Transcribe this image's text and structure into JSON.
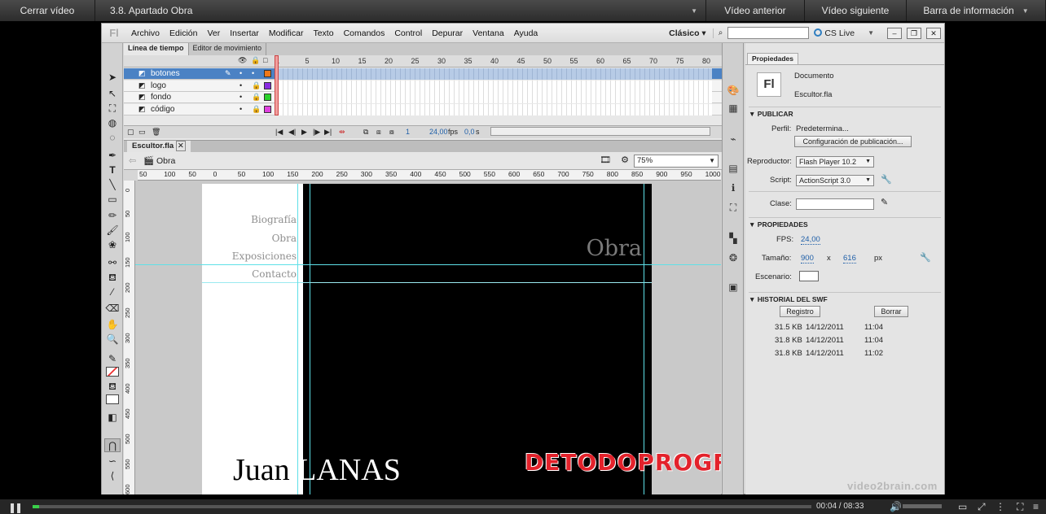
{
  "player": {
    "close_label": "Cerrar vídeo",
    "title": "3.8. Apartado Obra",
    "prev_label": "Vídeo anterior",
    "next_label": "Vídeo siguiente",
    "info_label": "Barra de información",
    "time": "00:04 / 08:33",
    "progress": 0.008,
    "brand": "video2brain.com"
  },
  "app": {
    "logo": "Fl",
    "menu": [
      "Archivo",
      "Edición",
      "Ver",
      "Insertar",
      "Modificar",
      "Texto",
      "Comandos",
      "Control",
      "Depurar",
      "Ventana",
      "Ayuda"
    ],
    "workspace": "Clásico",
    "search_value": "",
    "cslive": "CS Live"
  },
  "timeline": {
    "tabs": [
      "Línea de tiempo",
      "Editor de movimiento"
    ],
    "frame_numbers": [
      "1",
      "5",
      "10",
      "15",
      "20",
      "25",
      "30",
      "35",
      "40",
      "45",
      "50",
      "55",
      "60",
      "65",
      "70",
      "75",
      "80"
    ],
    "layers": [
      {
        "name": "botones",
        "color": "#f07818",
        "selected": true
      },
      {
        "name": "logo",
        "color": "#8a2be2",
        "selected": false
      },
      {
        "name": "fondo",
        "color": "#2bd12b",
        "selected": false
      },
      {
        "name": "código",
        "color": "#e040e0",
        "selected": false
      }
    ],
    "fps": "24,00",
    "fps_unit": "fps",
    "time": "0,0",
    "time_unit": "s",
    "frame": "1"
  },
  "document": {
    "tab": "Escultor.fla",
    "scene": "Obra",
    "zoom": "75%",
    "hruler": [
      "50",
      "100",
      "50",
      "0",
      "50",
      "100",
      "150",
      "200",
      "250",
      "300",
      "350",
      "400",
      "450",
      "500",
      "550",
      "600",
      "650",
      "700",
      "750",
      "800",
      "850",
      "900",
      "950",
      "1000"
    ],
    "vruler": [
      "0",
      "50",
      "100",
      "150",
      "200",
      "250",
      "300",
      "350",
      "400",
      "450",
      "500",
      "550",
      "600"
    ]
  },
  "stage": {
    "menu_items": [
      "Biografía",
      "Obra",
      "Exposiciones",
      "Contacto"
    ],
    "section_title": "Obra",
    "signature_dark": "Juan",
    "signature_light": "LANAS",
    "watermark": "DETODOPROGRAMAS.COM"
  },
  "properties": {
    "tab": "Propiedades",
    "doc_type": "Documento",
    "doc_name": "Escultor.fla",
    "publish_section": "PUBLICAR",
    "profile_label": "Perfil:",
    "profile_value": "Predetermina...",
    "publish_config_button": "Configuración de publicación...",
    "player_label": "Reproductor:",
    "player_value": "Flash Player 10.2",
    "script_label": "Script:",
    "script_value": "ActionScript 3.0",
    "class_label": "Clase:",
    "properties_section": "PROPIEDADES",
    "fps_label": "FPS:",
    "fps_value": "24,00",
    "size_label": "Tamaño:",
    "width": "900",
    "x_sep": "x",
    "height": "616",
    "unit": "px",
    "stage_label": "Escenario:",
    "stage_color": "#ffffff",
    "history_section": "HISTORIAL DEL SWF",
    "log_button": "Registro",
    "clear_button": "Borrar",
    "history": [
      {
        "size": "31.5 KB",
        "date": "14/12/2011",
        "time": "11:04"
      },
      {
        "size": "31.8 KB",
        "date": "14/12/2011",
        "time": "11:04"
      },
      {
        "size": "31.8 KB",
        "date": "14/12/2011",
        "time": "11:02"
      }
    ]
  }
}
